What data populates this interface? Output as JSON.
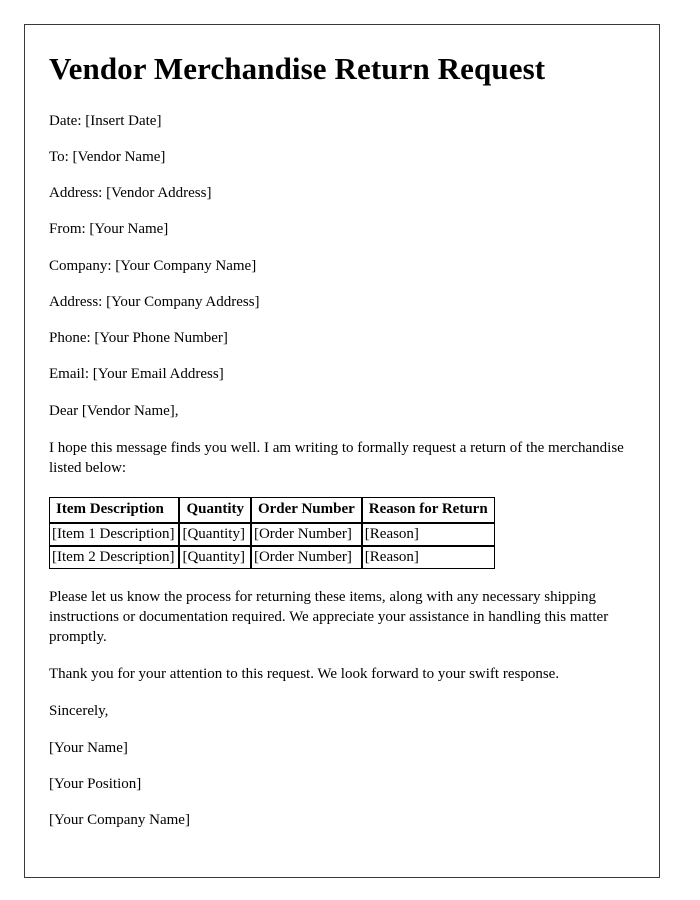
{
  "document": {
    "title": "Vendor Merchandise Return Request",
    "header_fields": [
      "Date: [Insert Date]",
      "To: [Vendor Name]",
      "Address: [Vendor Address]",
      "From: [Your Name]",
      "Company: [Your Company Name]",
      "Address: [Your Company Address]",
      "Phone: [Your Phone Number]",
      "Email: [Your Email Address]"
    ],
    "salutation": "Dear [Vendor Name],",
    "intro_paragraph": "I hope this message finds you well. I am writing to formally request a return of the merchandise listed below:",
    "table": {
      "headers": [
        "Item Description",
        "Quantity",
        "Order Number",
        "Reason for Return"
      ],
      "rows": [
        [
          "[Item 1 Description]",
          "[Quantity]",
          "[Order Number]",
          "[Reason]"
        ],
        [
          "[Item 2 Description]",
          "[Quantity]",
          "[Order Number]",
          "[Reason]"
        ]
      ]
    },
    "body_paragraphs": [
      "Please let us know the process for returning these items, along with any necessary shipping instructions or documentation required. We appreciate your assistance in handling this matter promptly.",
      "Thank you for your attention to this request. We look forward to your swift response."
    ],
    "closing": "Sincerely,",
    "signature_lines": [
      "[Your Name]",
      "[Your Position]",
      "[Your Company Name]"
    ]
  }
}
